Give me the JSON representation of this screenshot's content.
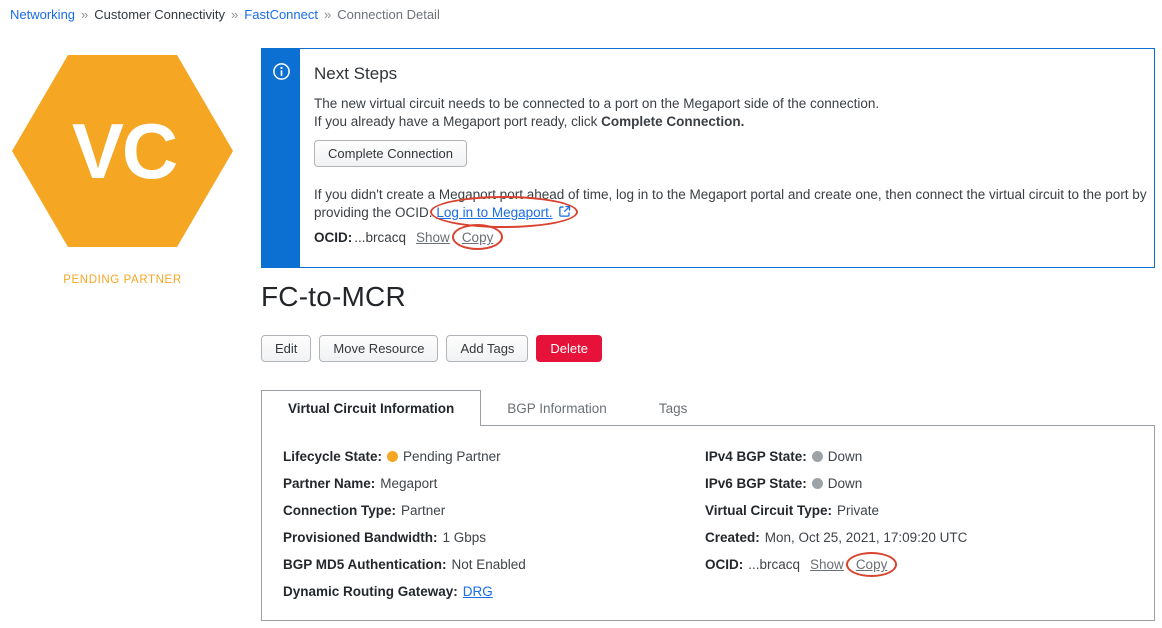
{
  "breadcrumb": {
    "separator": "»",
    "items": [
      {
        "label": "Networking",
        "style": "link"
      },
      {
        "label": "Customer Connectivity",
        "style": "text"
      },
      {
        "label": "FastConnect",
        "style": "link"
      },
      {
        "label": "Connection Detail",
        "style": "muted"
      }
    ]
  },
  "resource": {
    "hexagon_label": "VC",
    "status_label": "PENDING PARTNER"
  },
  "next_steps": {
    "title": "Next Steps",
    "line1": "The new virtual circuit needs to be connected to a port on the Megaport side of the connection.",
    "line2_prefix": "If you already have a Megaport port ready, click ",
    "line2_bold": "Complete Connection.",
    "complete_button": "Complete Connection",
    "line3": "If you didn't create a Megaport port ahead of time, log in to the Megaport portal and create one, then connect the virtual circuit to the port by",
    "line4_prefix": "providing the OCID. ",
    "login_link": "Log in to Megaport.",
    "ocid_label": "OCID:",
    "ocid_value": "...brcacq",
    "show_link": "Show",
    "copy_link": "Copy"
  },
  "page": {
    "title": "FC-to-MCR"
  },
  "actions": [
    {
      "label": "Edit",
      "style": "default"
    },
    {
      "label": "Move Resource",
      "style": "default"
    },
    {
      "label": "Add Tags",
      "style": "default"
    },
    {
      "label": "Delete",
      "style": "danger"
    }
  ],
  "tabs": [
    {
      "label": "Virtual Circuit Information",
      "active": true
    },
    {
      "label": "BGP Information",
      "active": false
    },
    {
      "label": "Tags",
      "active": false
    }
  ],
  "details": {
    "left": [
      {
        "label": "Lifecycle State:",
        "value": "Pending Partner",
        "dot": "#F5A623"
      },
      {
        "label": "Partner Name:",
        "value": "Megaport"
      },
      {
        "label": "Connection Type:",
        "value": "Partner"
      },
      {
        "label": "Provisioned Bandwidth:",
        "value": "1 Gbps"
      },
      {
        "label": "BGP MD5 Authentication:",
        "value": "Not Enabled"
      },
      {
        "label": "Dynamic Routing Gateway:",
        "value": "DRG",
        "value_link": true
      }
    ],
    "right": [
      {
        "label": "IPv4 BGP State:",
        "value": "Down",
        "dot": "#9EA3A8"
      },
      {
        "label": "IPv6 BGP State:",
        "value": "Down",
        "dot": "#9EA3A8"
      },
      {
        "label": "Virtual Circuit Type:",
        "value": "Private"
      },
      {
        "label": "Created:",
        "value": "Mon, Oct 25, 2021, 17:09:20 UTC"
      },
      {
        "label": "OCID:",
        "value": "...brcacq",
        "links": [
          {
            "text": "Show",
            "circled": false
          },
          {
            "text": "Copy",
            "circled": true
          }
        ]
      }
    ]
  },
  "colors": {
    "accent_orange": "#F5A623",
    "info_blue": "#0C6FD2",
    "link_blue": "#1A6CE8",
    "danger_red": "#E6123A",
    "annotation_red": "#D9432F",
    "muted_dot_gray": "#9EA3A8"
  }
}
